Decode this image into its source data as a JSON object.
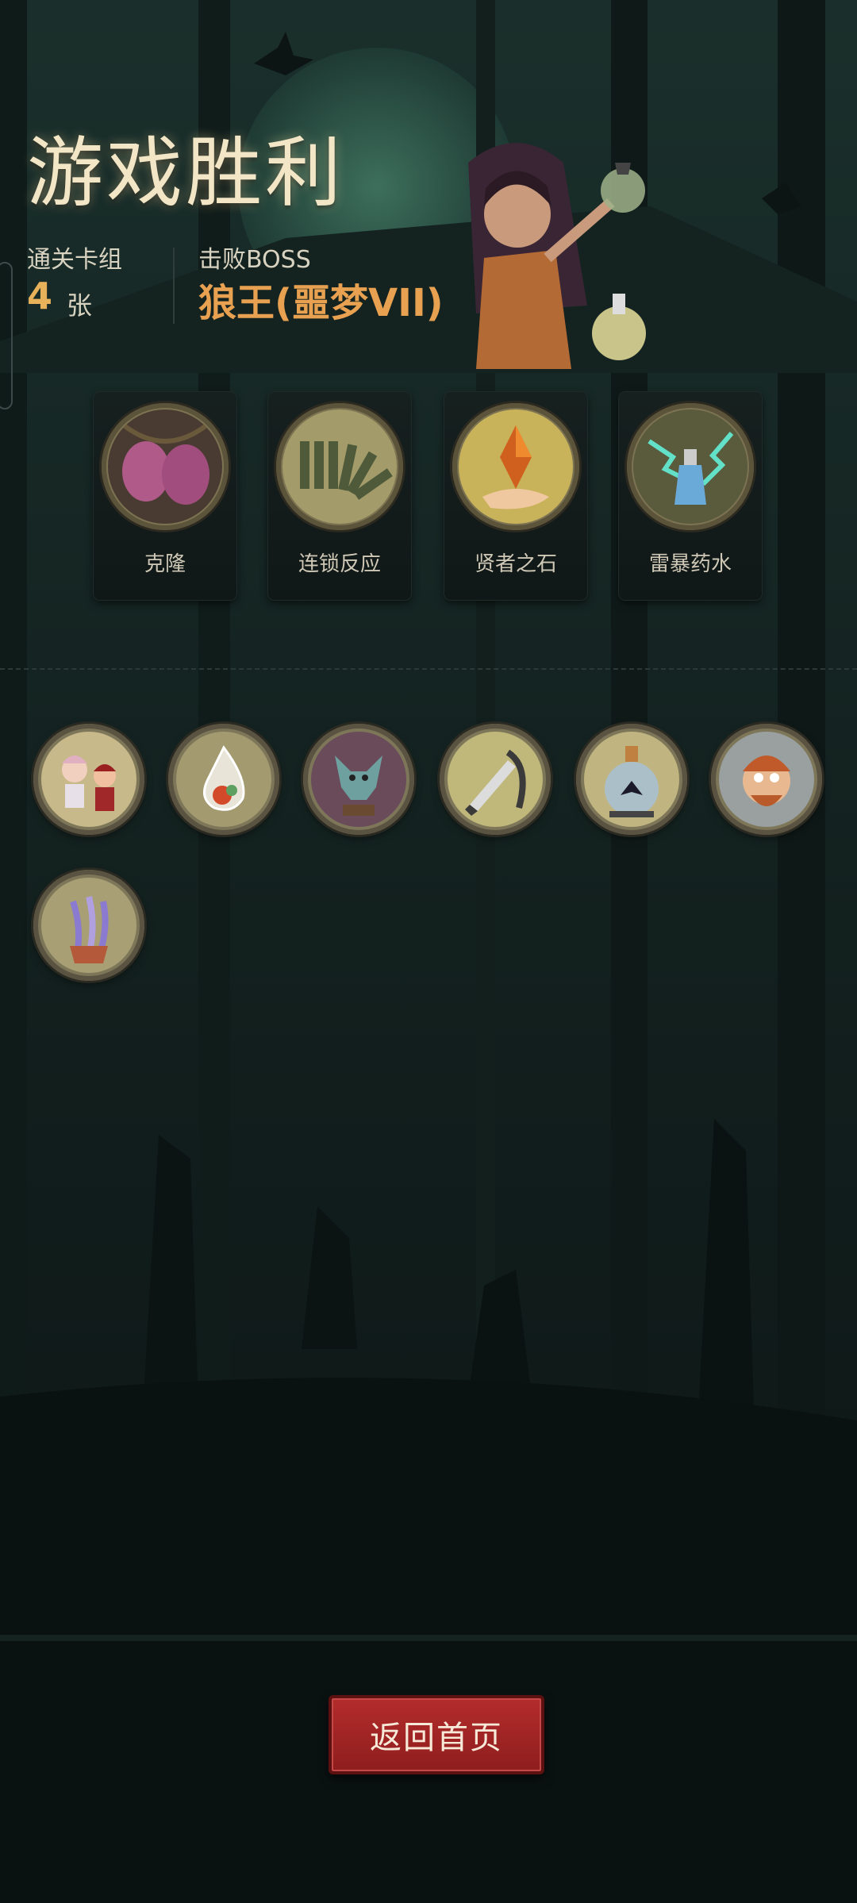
{
  "header": {
    "title": "游戏胜利",
    "deck_label": "通关卡组",
    "deck_count": "4",
    "deck_unit": "张",
    "boss_label": "击败BOSS",
    "boss_name": "狼王(噩梦VII)"
  },
  "cards": [
    {
      "name": "克隆",
      "icon": "clone-eggs-icon"
    },
    {
      "name": "连锁反应",
      "icon": "domino-icon"
    },
    {
      "name": "贤者之石",
      "icon": "philosopher-stone-icon"
    },
    {
      "name": "雷暴药水",
      "icon": "storm-potion-icon"
    }
  ],
  "relics": [
    {
      "icon": "musician-children-icon"
    },
    {
      "icon": "fire-droplet-icon"
    },
    {
      "icon": "gargoyle-statue-icon"
    },
    {
      "icon": "dagger-scythe-icon"
    },
    {
      "icon": "crow-in-bottle-icon"
    },
    {
      "icon": "frightened-man-icon"
    },
    {
      "icon": "spirit-hand-potion-icon"
    }
  ],
  "footer": {
    "return_label": "返回首页"
  },
  "colors": {
    "background": "#0d1716",
    "title": "#f3e6c6",
    "accent_gold": "#e8b25a",
    "boss_orange": "#e8a150",
    "button_red": "#b42c2c"
  }
}
